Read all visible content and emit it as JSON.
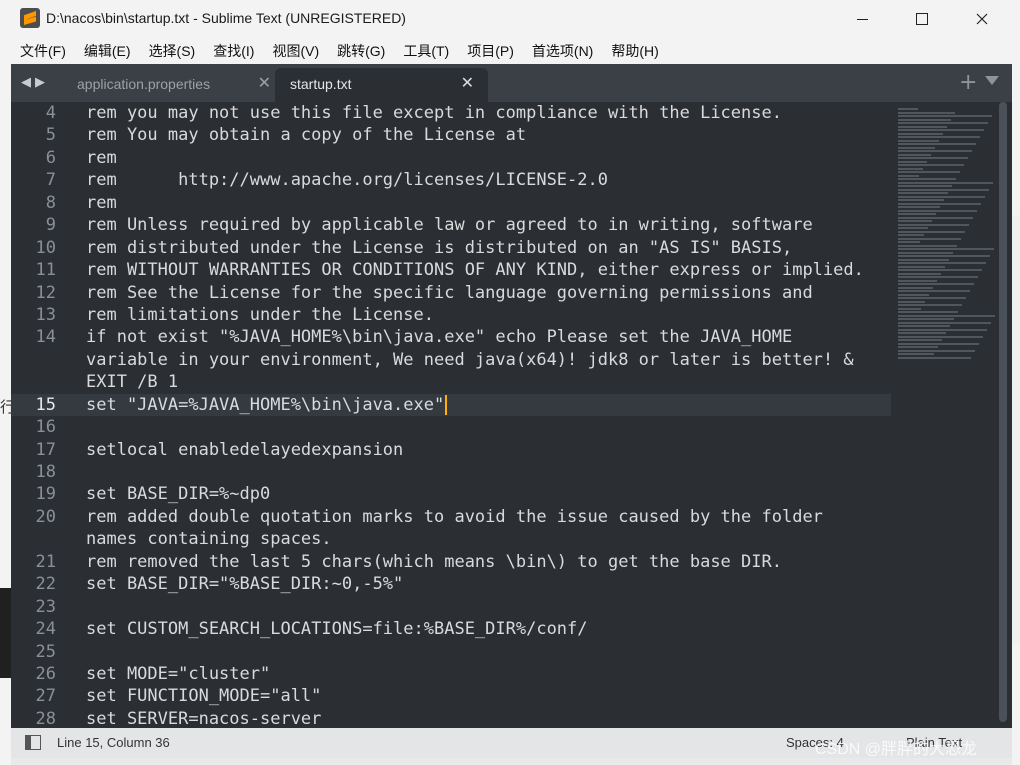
{
  "window": {
    "title": "D:\\nacos\\bin\\startup.txt - Sublime Text (UNREGISTERED)"
  },
  "menu": [
    "文件(F)",
    "编辑(E)",
    "选择(S)",
    "查找(I)",
    "视图(V)",
    "跳转(G)",
    "工具(T)",
    "项目(P)",
    "首选项(N)",
    "帮助(H)"
  ],
  "tabs": {
    "inactive_label": "application.properties",
    "active_label": "startup.txt",
    "close_glyph": "✕",
    "plus_glyph": "+"
  },
  "code_lines": [
    {
      "num": "4",
      "text": "rem you may not use this file except in compliance with the License."
    },
    {
      "num": "5",
      "text": "rem You may obtain a copy of the License at"
    },
    {
      "num": "6",
      "text": "rem"
    },
    {
      "num": "7",
      "text": "rem      http://www.apache.org/licenses/LICENSE-2.0"
    },
    {
      "num": "8",
      "text": "rem"
    },
    {
      "num": "9",
      "text": "rem Unless required by applicable law or agreed to in writing, software"
    },
    {
      "num": "10",
      "text": "rem distributed under the License is distributed on an \"AS IS\" BASIS,"
    },
    {
      "num": "11",
      "text": "rem WITHOUT WARRANTIES OR CONDITIONS OF ANY KIND, either express or implied."
    },
    {
      "num": "12",
      "text": "rem See the License for the specific language governing permissions and"
    },
    {
      "num": "13",
      "text": "rem limitations under the License."
    },
    {
      "num": "14",
      "text": "if not exist \"%JAVA_HOME%\\bin\\java.exe\" echo Please set the JAVA_HOME"
    },
    {
      "num": "",
      "text": "variable in your environment, We need java(x64)! jdk8 or later is better! &"
    },
    {
      "num": "",
      "text": "EXIT /B 1"
    },
    {
      "num": "15",
      "text": "set \"JAVA=%JAVA_HOME%\\bin\\java.exe\"",
      "current": true
    },
    {
      "num": "16",
      "text": ""
    },
    {
      "num": "17",
      "text": "setlocal enabledelayedexpansion"
    },
    {
      "num": "18",
      "text": ""
    },
    {
      "num": "19",
      "text": "set BASE_DIR=%~dp0"
    },
    {
      "num": "20",
      "text": "rem added double quotation marks to avoid the issue caused by the folder"
    },
    {
      "num": "",
      "text": "names containing spaces."
    },
    {
      "num": "21",
      "text": "rem removed the last 5 chars(which means \\bin\\) to get the base DIR."
    },
    {
      "num": "22",
      "text": "set BASE_DIR=\"%BASE_DIR:~0,-5%\""
    },
    {
      "num": "23",
      "text": ""
    },
    {
      "num": "24",
      "text": "set CUSTOM_SEARCH_LOCATIONS=file:%BASE_DIR%/conf/"
    },
    {
      "num": "25",
      "text": ""
    },
    {
      "num": "26",
      "text": "set MODE=\"cluster\""
    },
    {
      "num": "27",
      "text": "set FUNCTION_MODE=\"all\""
    },
    {
      "num": "28",
      "text": "set SERVER=nacos-server"
    }
  ],
  "status": {
    "position": "Line 15, Column 36",
    "spaces": "Spaces: 4",
    "syntax": "Plain Text"
  },
  "watermark": "CSDN @胖胖的大恐龙",
  "colors": {
    "editor_bg": "#2b2f33",
    "caret": "#ffb000",
    "tabbar_bg": "#3b4047",
    "app_icon": "#ff9800"
  }
}
